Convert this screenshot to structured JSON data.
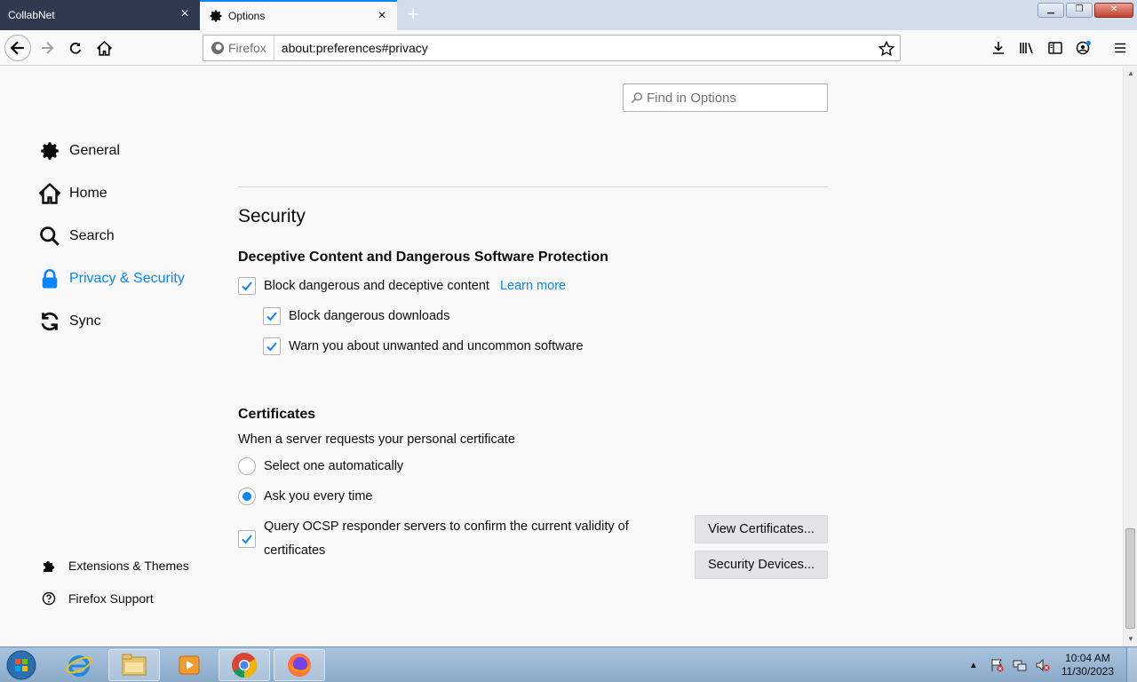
{
  "browser": {
    "tabs": [
      {
        "title": "CollabNet",
        "active": false
      },
      {
        "title": "Options",
        "active": true
      }
    ],
    "new_tab_symbol": "+",
    "url_identity": "Firefox",
    "url": "about:preferences#privacy"
  },
  "sidebar": {
    "categories": [
      {
        "label": "General",
        "icon": "gear-icon"
      },
      {
        "label": "Home",
        "icon": "home-icon"
      },
      {
        "label": "Search",
        "icon": "search-icon"
      },
      {
        "label": "Privacy & Security",
        "icon": "lock-icon",
        "selected": true
      },
      {
        "label": "Sync",
        "icon": "sync-icon"
      }
    ],
    "footer": [
      {
        "label": "Extensions & Themes",
        "icon": "puzzle-icon"
      },
      {
        "label": "Firefox Support",
        "icon": "help-icon"
      }
    ]
  },
  "search": {
    "placeholder": "Find in Options"
  },
  "security": {
    "heading": "Security",
    "deceptive": {
      "heading": "Deceptive Content and Dangerous Software Protection",
      "block_label": "Block dangerous and deceptive content",
      "learn_more": "Learn more",
      "downloads_label": "Block dangerous downloads",
      "unwanted_label": "Warn you about unwanted and uncommon software",
      "block_checked": true,
      "downloads_checked": true,
      "unwanted_checked": true
    },
    "certificates": {
      "heading": "Certificates",
      "description": "When a server requests your personal certificate",
      "auto_label": "Select one automatically",
      "ask_label": "Ask you every time",
      "selected_option": "ask",
      "ocsp_label": "Query OCSP responder servers to confirm the current validity of certificates",
      "ocsp_checked": true,
      "view_button": "View Certificates...",
      "devices_button": "Security Devices..."
    }
  },
  "taskbar": {
    "clock_time": "10:04 AM",
    "clock_date": "11/30/2023",
    "apps": [
      "internet-explorer-icon",
      "file-explorer-icon",
      "media-player-icon",
      "chrome-icon",
      "firefox-icon"
    ]
  },
  "colors": {
    "accent": "#0a84ff",
    "tab_inactive_bg": "#2f3a4e",
    "page_bg": "#f9f9fa"
  }
}
